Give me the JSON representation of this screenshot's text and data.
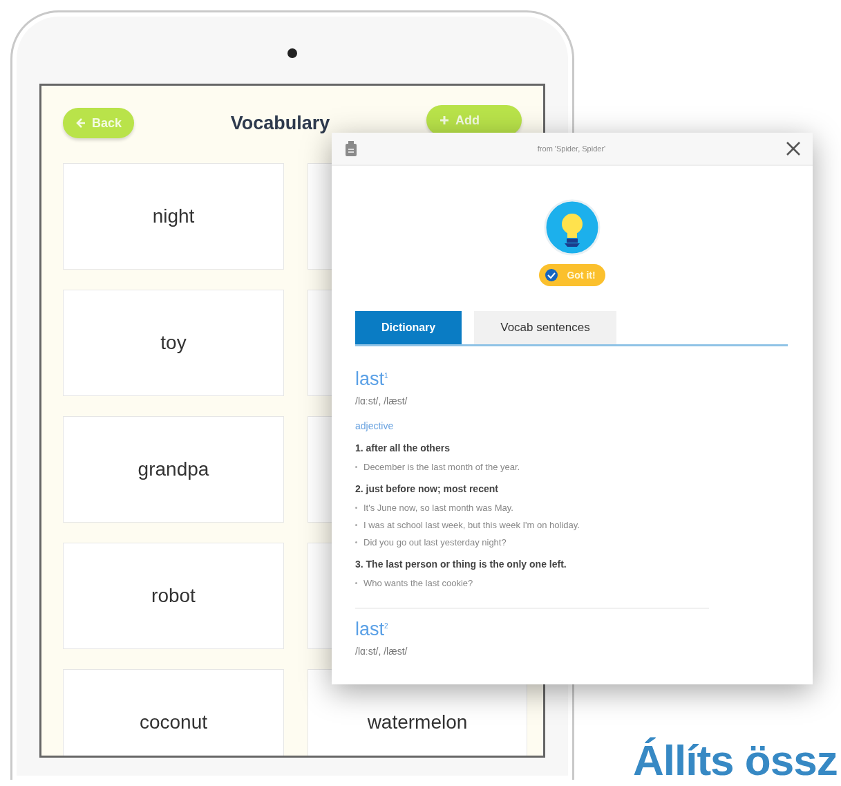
{
  "screen": {
    "back_button": "Back",
    "title": "Vocabulary",
    "add_button": "Add",
    "left_cards": [
      "night",
      "toy",
      "grandpa",
      "robot",
      "coconut"
    ],
    "right_cards": [
      "watermelon"
    ]
  },
  "popup": {
    "source": "from 'Spider, Spider'",
    "got_it_button": "Got it!",
    "tabs": [
      {
        "label": "Dictionary",
        "selected": true
      },
      {
        "label": "Vocab sentences",
        "selected": false
      }
    ],
    "entries": [
      {
        "headword": "last$^{1}$",
        "pronunciation": "/lɑːst/, /læst/",
        "part_of_speech": "adjective",
        "senses": [
          {
            "definition": "1. after all the others",
            "examples": [
              "December is the last month of the year."
            ]
          },
          {
            "definition": "2. just before now; most recent",
            "examples": [
              "It's June now, so last month was May.",
              "I was at school last week, but this week I'm on holiday.",
              "Did you go out last yesterday night?"
            ]
          },
          {
            "definition": "3. The last person or thing is the only one left.",
            "examples": [
              "Who wants the last cookie?"
            ]
          }
        ]
      },
      {
        "headword": "last$^{2}$",
        "pronunciation": "/lɑːst/, /læst/"
      }
    ]
  },
  "heading": "Állíts össz"
}
